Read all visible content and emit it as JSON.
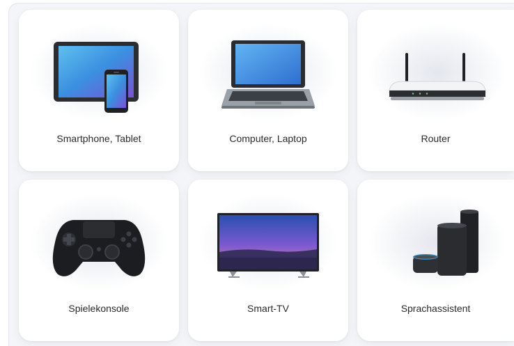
{
  "devices": [
    {
      "label": "Smartphone, Tablet",
      "icon": "tablet-smartphone-icon"
    },
    {
      "label": "Computer, Laptop",
      "icon": "laptop-icon"
    },
    {
      "label": "Router",
      "icon": "router-icon"
    },
    {
      "label": "Spielekonsole",
      "icon": "gamepad-icon"
    },
    {
      "label": "Smart-TV",
      "icon": "tv-icon"
    },
    {
      "label": "Sprachassistent",
      "icon": "smart-speaker-icon"
    }
  ]
}
